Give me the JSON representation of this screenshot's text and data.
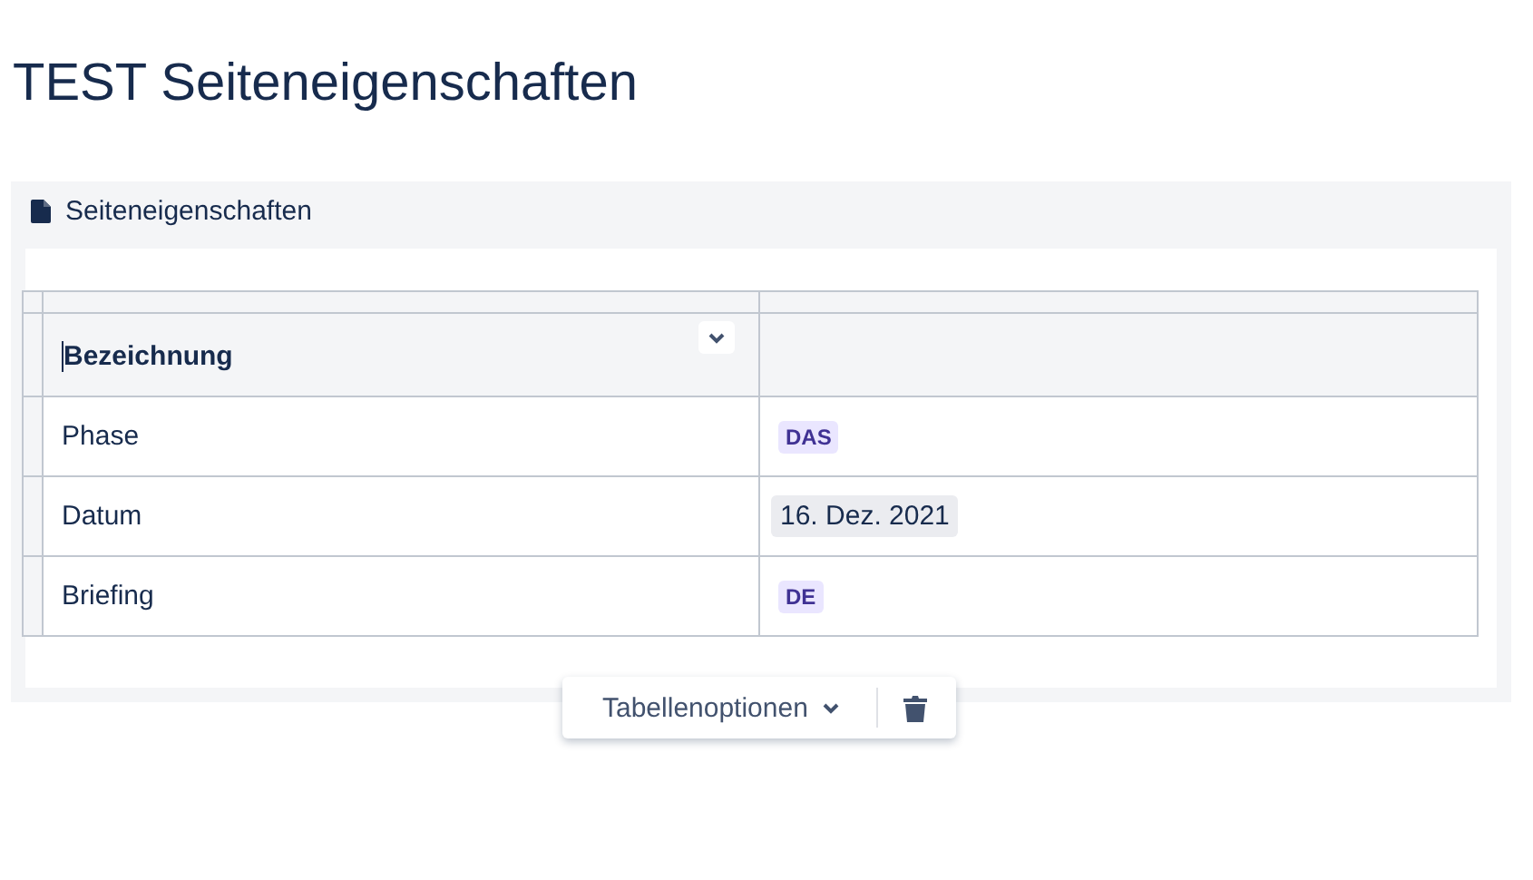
{
  "page": {
    "title": "TEST Seiteneigenschaften"
  },
  "macro": {
    "label": "Seiteneigenschaften"
  },
  "table": {
    "header": "Bezeichnung",
    "rows": [
      {
        "key": "Phase",
        "value": {
          "kind": "status",
          "text": "DAS"
        }
      },
      {
        "key": "Datum",
        "value": {
          "kind": "date",
          "text": "16. Dez. 2021"
        }
      },
      {
        "key": "Briefing",
        "value": {
          "kind": "status",
          "text": "DE"
        }
      }
    ]
  },
  "toolbar": {
    "options": "Tabellenoptionen"
  }
}
